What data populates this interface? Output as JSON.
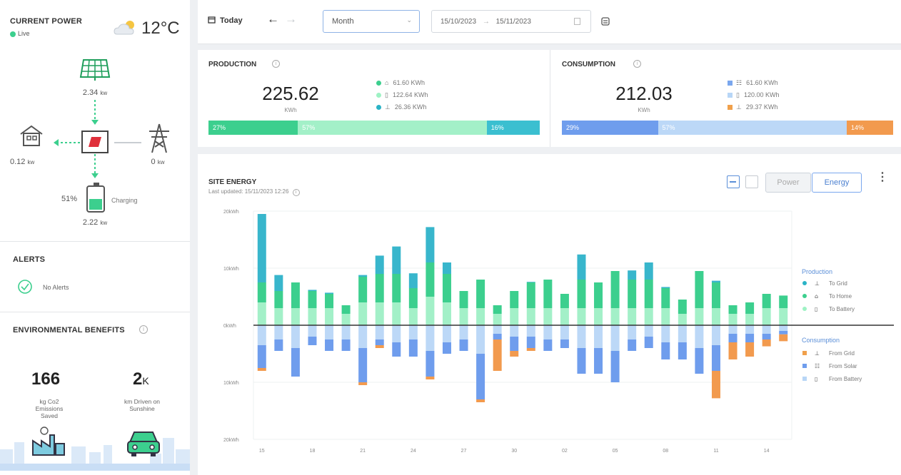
{
  "current_power": {
    "title": "CURRENT POWER",
    "status": "Live",
    "temperature": "12°C",
    "solar_value": "2.34",
    "solar_unit": "kw",
    "home_value": "0.12",
    "home_unit": "kw",
    "grid_value": "0",
    "grid_unit": "kw",
    "battery_percent": "51%",
    "battery_state": "Charging",
    "battery_level": 0.51,
    "battery_value": "2.22",
    "battery_unit": "kw"
  },
  "alerts": {
    "title": "ALERTS",
    "message": "No Alerts"
  },
  "environment": {
    "title": "ENVIRONMENTAL BENEFITS",
    "co2_value": "166",
    "co2_label_1": "kg Co2",
    "co2_label_2": "Emissions",
    "co2_label_3": "Saved",
    "km_value": "2",
    "km_suffix": "K",
    "km_label_1": "km Driven on",
    "km_label_2": "Sunshine"
  },
  "toolbar": {
    "today_label": "Today",
    "period_value": "Month",
    "date_from": "15/10/2023",
    "date_to": "15/11/2023"
  },
  "production": {
    "title": "PRODUCTION",
    "total": "225.62",
    "unit": "KWh",
    "rows": [
      {
        "value": "61.60 KWh",
        "color": "#3ccf8e"
      },
      {
        "value": "122.64 KWh",
        "color": "#9ef2c4"
      },
      {
        "value": "26.36 KWh",
        "color": "#2ab3c6"
      }
    ],
    "bar": [
      {
        "label": "27%",
        "pct": 27,
        "color": "#3ccf8e"
      },
      {
        "label": "57%",
        "pct": 57,
        "color": "#a3f0c8"
      },
      {
        "label": "16%",
        "pct": 16,
        "color": "#3bbfd0"
      }
    ]
  },
  "consumption": {
    "title": "CONSUMPTION",
    "total": "212.03",
    "unit": "KWh",
    "rows": [
      {
        "value": "61.60 KWh",
        "color": "#7aa7ee"
      },
      {
        "value": "120.00 KWh",
        "color": "#b8d6f6"
      },
      {
        "value": "29.37 KWh",
        "color": "#f0a04b"
      }
    ],
    "bar": [
      {
        "label": "29%",
        "pct": 29,
        "color": "#6f9ded"
      },
      {
        "label": "57%",
        "pct": 57,
        "color": "#bcd8f7"
      },
      {
        "label": "14%",
        "pct": 14,
        "color": "#f29a4e"
      }
    ]
  },
  "site_energy": {
    "title": "SITE ENERGY",
    "last_updated": "Last updated: 15/11/2023 12:26",
    "toggle_power": "Power",
    "toggle_energy": "Energy"
  },
  "chart_data": {
    "type": "bar",
    "stacked": true,
    "y_unit": "kWh",
    "ylim": [
      -20,
      20
    ],
    "yticks": [
      "20kWh",
      "10kWh",
      "0kWh",
      "10kWh",
      "20kWh"
    ],
    "xticks": [
      {
        "label": "15",
        "index": 0
      },
      {
        "label": "18",
        "index": 3
      },
      {
        "label": "21",
        "index": 6
      },
      {
        "label": "24",
        "index": 9
      },
      {
        "label": "27",
        "index": 12
      },
      {
        "label": "30",
        "index": 15
      },
      {
        "label": "02",
        "index": 18
      },
      {
        "label": "05",
        "index": 21
      },
      {
        "label": "08",
        "index": 24
      },
      {
        "label": "11",
        "index": 27
      },
      {
        "label": "14",
        "index": 30
      }
    ],
    "legend": {
      "production_title": "Production",
      "production": [
        {
          "name": "To Grid",
          "color": "#2ab3c6"
        },
        {
          "name": "To Home",
          "color": "#3ccf8e"
        },
        {
          "name": "To Battery",
          "color": "#9ef2c4"
        }
      ],
      "consumption_title": "Consumption",
      "consumption": [
        {
          "name": "From Grid",
          "color": "#f0a04b"
        },
        {
          "name": "From Solar",
          "color": "#6f9ded"
        },
        {
          "name": "From Battery",
          "color": "#b8d6f6"
        }
      ]
    },
    "production_series": {
      "to_battery": [
        4,
        3,
        3,
        3,
        3,
        2,
        4,
        4,
        4,
        3,
        5,
        4,
        3,
        3,
        2,
        3,
        3,
        3,
        3,
        3,
        3,
        3,
        3,
        3,
        3,
        2,
        3,
        3,
        2,
        2,
        3,
        3
      ],
      "to_home": [
        3.5,
        3,
        4.5,
        3,
        2.5,
        1.5,
        4.5,
        5,
        5,
        3.5,
        6,
        5,
        3,
        5,
        1.5,
        3,
        4.5,
        5,
        2.5,
        5,
        4.5,
        6.5,
        5,
        5,
        3.5,
        2.5,
        6.5,
        4.5,
        1.5,
        2,
        2.5,
        2.2
      ],
      "to_grid": [
        12,
        2.8,
        0,
        0.2,
        0.2,
        0,
        0.3,
        3.2,
        4.8,
        2.6,
        6.2,
        2,
        0,
        0,
        0,
        0,
        0.1,
        0,
        0,
        4.4,
        0,
        0,
        1.6,
        3,
        0.2,
        0,
        0,
        0.3,
        0,
        0,
        0,
        0
      ]
    },
    "consumption_series": {
      "from_battery": [
        3.5,
        2.5,
        4,
        2,
        2.5,
        2.5,
        4,
        2.5,
        3,
        2.5,
        4.5,
        3,
        2.5,
        5,
        1.5,
        2,
        2,
        2.5,
        2.5,
        4,
        4,
        4.5,
        2.5,
        2,
        3,
        3,
        4,
        3.5,
        1.5,
        1.5,
        1.5,
        1
      ],
      "from_solar": [
        4,
        2,
        5,
        1.5,
        2,
        2,
        6,
        1,
        2.5,
        3,
        4.5,
        2,
        2,
        8,
        1,
        2.5,
        2,
        2,
        1.5,
        4.5,
        4.5,
        5.5,
        2,
        2,
        3,
        3,
        4.5,
        4.5,
        1.5,
        1.5,
        1,
        0.6
      ],
      "from_grid": [
        0.5,
        0,
        0,
        0,
        0,
        0,
        0.5,
        0.5,
        0,
        0,
        0.5,
        0,
        0,
        0.5,
        5.5,
        1,
        0.5,
        0,
        0,
        0,
        0,
        0,
        0,
        0,
        0,
        0,
        0,
        4.8,
        3,
        2.5,
        1.2,
        1.2
      ]
    }
  }
}
